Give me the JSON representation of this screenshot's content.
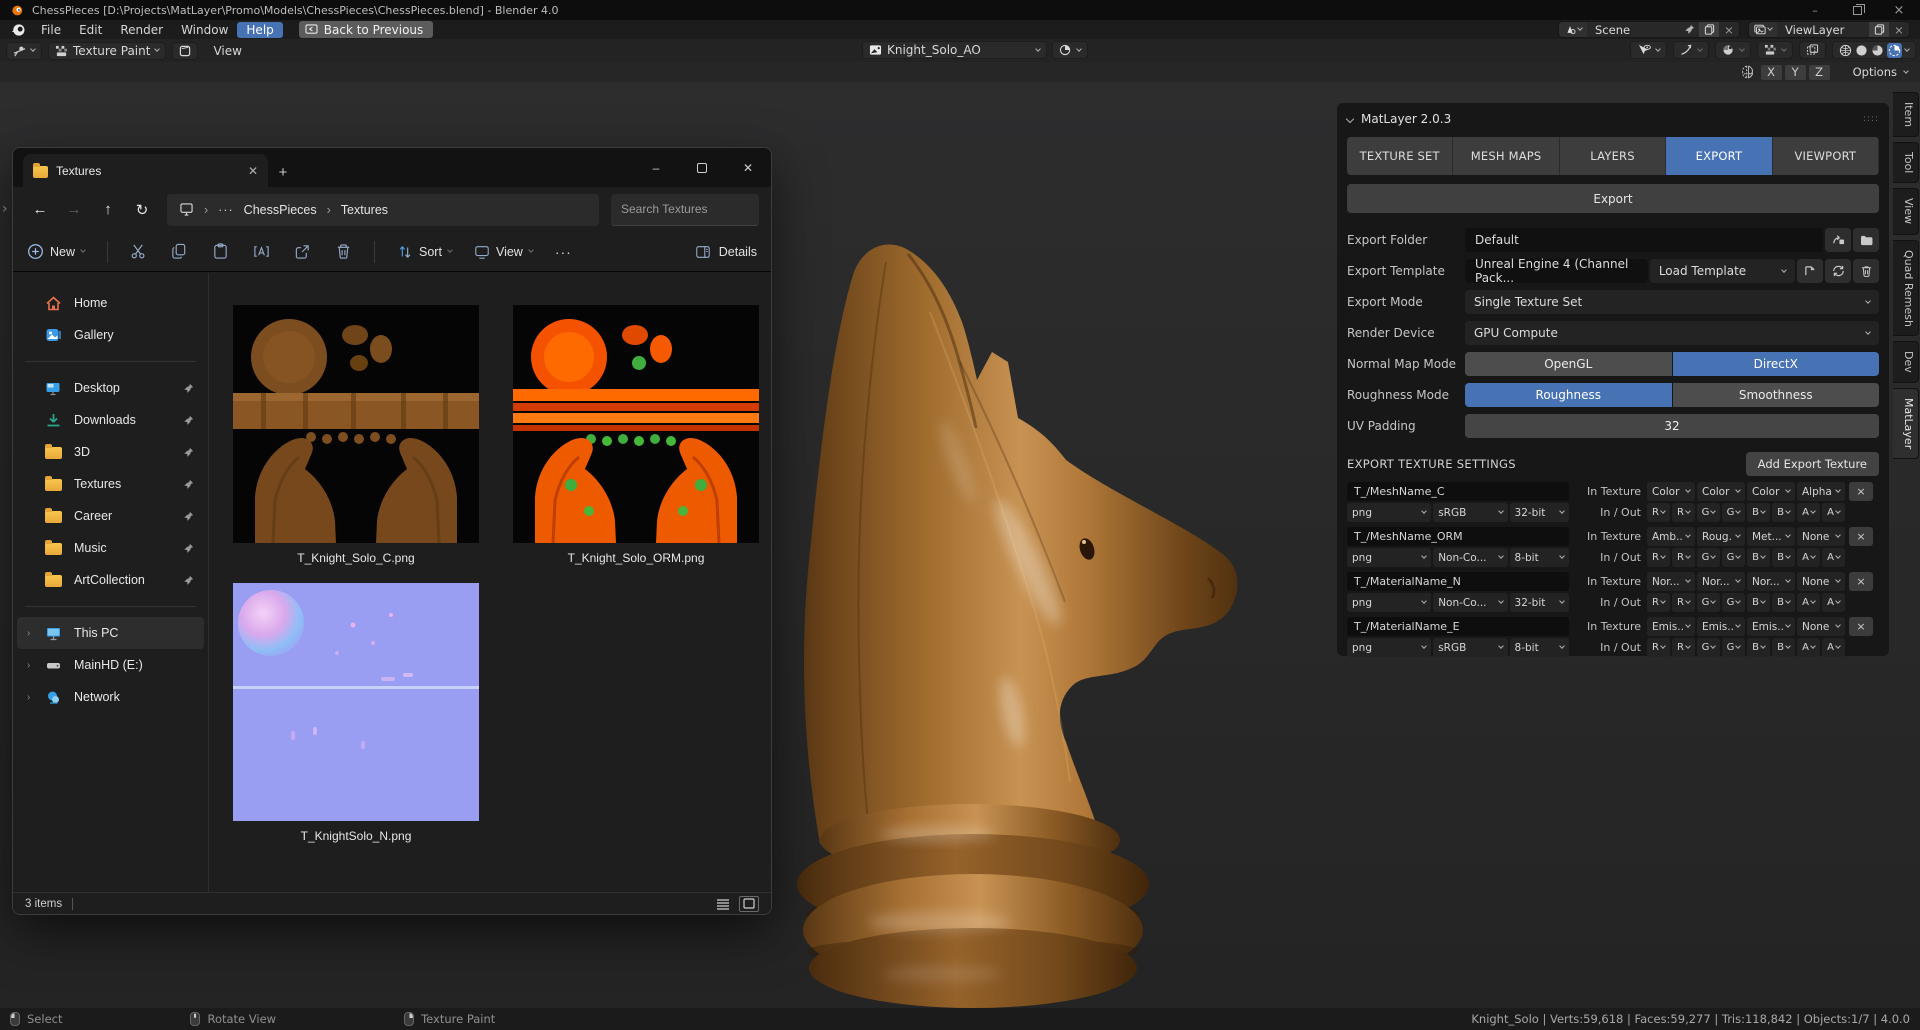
{
  "blender": {
    "window_title": "ChessPieces [D:\\Projects\\MatLayer\\Promo\\Models\\ChessPieces\\ChessPieces.blend] - Blender 4.0",
    "menubar": {
      "menus": [
        {
          "label": "File"
        },
        {
          "label": "Edit"
        },
        {
          "label": "Render"
        },
        {
          "label": "Window"
        },
        {
          "label": "Help",
          "active": true
        }
      ],
      "back_button": "Back to Previous",
      "scene_name": "Scene",
      "view_layer_name": "ViewLayer"
    },
    "editor_header": {
      "mode": "Texture Paint",
      "view_menu": "View",
      "image_name": "Knight_Solo_AO"
    },
    "tool_settings": {
      "axis_buttons": [
        {
          "label": "X"
        },
        {
          "label": "Y"
        },
        {
          "label": "Z"
        }
      ],
      "options_label": "Options"
    },
    "npanel_tabs": [
      {
        "label": "Item"
      },
      {
        "label": "Tool"
      },
      {
        "label": "View"
      },
      {
        "label": "Quad Remesh"
      },
      {
        "label": "Dev"
      },
      {
        "label": "MatLayer",
        "active": true
      }
    ],
    "statusbar": {
      "select": "Select",
      "rotate_view": "Rotate View",
      "texture_paint": "Texture Paint",
      "stats": "Knight_Solo | Verts:59,618 | Faces:59,277 | Tris:118,842 | Objects:1/7 | 4.0.0"
    }
  },
  "explorer": {
    "tab_title": "Textures",
    "breadcrumb": {
      "items": [
        "ChessPieces",
        "Textures"
      ]
    },
    "search_placeholder": "Search Textures",
    "toolbar": {
      "new": "New",
      "sort": "Sort",
      "view": "View",
      "details": "Details"
    },
    "sidebar": {
      "home": "Home",
      "gallery": "Gallery",
      "pinned": [
        {
          "label": "Desktop"
        },
        {
          "label": "Downloads"
        },
        {
          "label": "3D"
        },
        {
          "label": "Textures"
        },
        {
          "label": "Career"
        },
        {
          "label": "Music"
        },
        {
          "label": "ArtCollection"
        }
      ],
      "tree": [
        {
          "label": "This PC",
          "selected": true
        },
        {
          "label": "MainHD (E:)"
        },
        {
          "label": "Network"
        }
      ]
    },
    "files": [
      {
        "name": "T_Knight_Solo_C.png"
      },
      {
        "name": "T_Knight_Solo_ORM.png"
      },
      {
        "name": "T_KnightSolo_N.png"
      }
    ],
    "status_count": "3 items"
  },
  "matlayer": {
    "panel_title": "MatLayer 2.0.3",
    "tabs": [
      {
        "label": "TEXTURE SET"
      },
      {
        "label": "MESH MAPS"
      },
      {
        "label": "LAYERS"
      },
      {
        "label": "EXPORT",
        "active": true
      },
      {
        "label": "VIEWPORT"
      }
    ],
    "export_button": "Export",
    "export_folder": {
      "label": "Export Folder",
      "value": "Default"
    },
    "export_template": {
      "label": "Export Template",
      "value": "Unreal Engine 4 (Channel Pack...",
      "load_button": "Load Template"
    },
    "export_mode": {
      "label": "Export Mode",
      "value": "Single Texture Set"
    },
    "render_device": {
      "label": "Render Device",
      "value": "GPU Compute"
    },
    "normal_map_mode": {
      "label": "Normal Map Mode",
      "options": [
        "OpenGL",
        "DirectX"
      ],
      "selected": "DirectX"
    },
    "roughness_mode": {
      "label": "Roughness Mode",
      "options": [
        "Roughness",
        "Smoothness"
      ],
      "selected": "Roughness"
    },
    "uv_padding": {
      "label": "UV Padding",
      "value": "32"
    },
    "texture_settings_header": "EXPORT TEXTURE SETTINGS",
    "add_texture_button": "Add Export Texture",
    "in_texture_label": "In Texture",
    "in_out_label": "In / Out",
    "channel_letters": [
      {
        "label": "R"
      },
      {
        "label": "R"
      },
      {
        "label": "G"
      },
      {
        "label": "G"
      },
      {
        "label": "B"
      },
      {
        "label": "B"
      },
      {
        "label": "A"
      },
      {
        "label": "A"
      }
    ],
    "rows": [
      {
        "name": "T_/MeshName_C",
        "format": "png",
        "colorspace": "sRGB",
        "bit_depth": "32-bit",
        "channels": [
          "Color",
          "Color",
          "Color",
          "Alpha"
        ]
      },
      {
        "name": "T_/MeshName_ORM",
        "format": "png",
        "colorspace": "Non-Co...",
        "bit_depth": "8-bit",
        "channels": [
          "Amb...",
          "Roug...",
          "Met...",
          "None"
        ]
      },
      {
        "name": "T_/MaterialName_N",
        "format": "png",
        "colorspace": "Non-Co...",
        "bit_depth": "32-bit",
        "channels": [
          "Nor...",
          "Nor...",
          "Nor...",
          "None"
        ]
      },
      {
        "name": "T_/MaterialName_E",
        "format": "png",
        "colorspace": "sRGB",
        "bit_depth": "8-bit",
        "channels": [
          "Emis...",
          "Emis...",
          "Emis...",
          "None"
        ]
      }
    ]
  }
}
